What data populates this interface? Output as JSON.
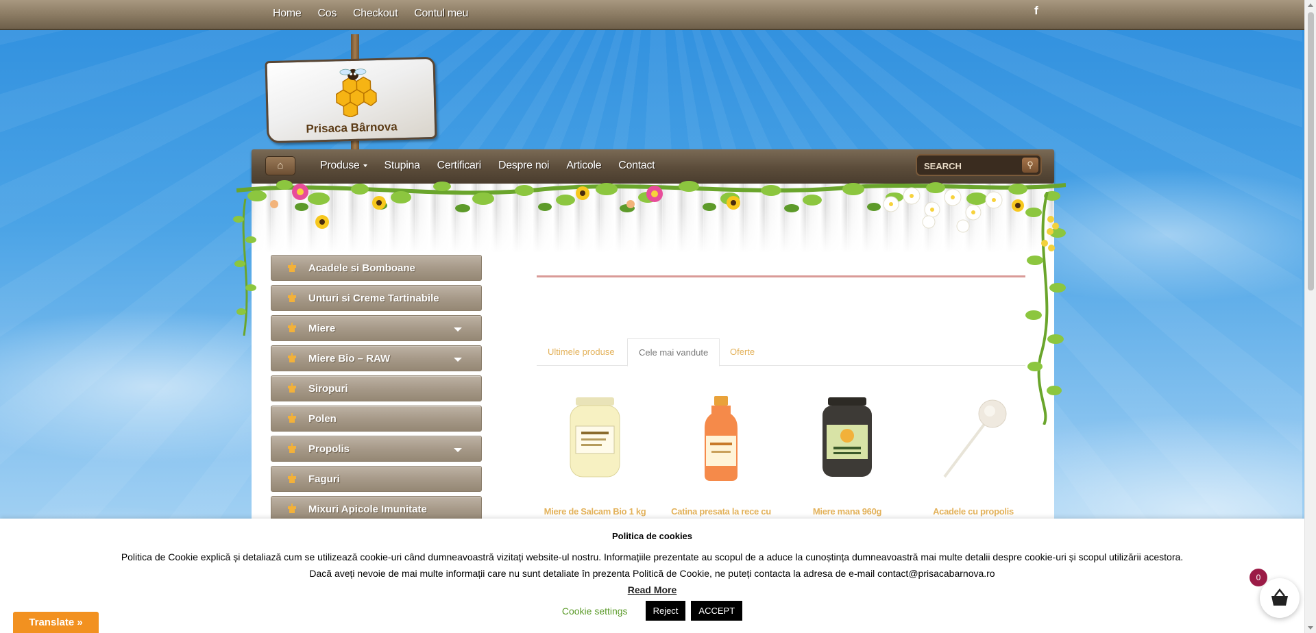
{
  "topbar": {
    "links": [
      "Home",
      "Cos",
      "Checkout",
      "Contul meu"
    ],
    "facebook_icon": "f"
  },
  "logo": {
    "text": "Prisaca Bârnova"
  },
  "mainnav": {
    "home_icon": "home-icon",
    "links": [
      "Produse",
      "Stupina",
      "Certificari",
      "Despre noi",
      "Articole",
      "Contact"
    ],
    "search_placeholder": "SEARCH"
  },
  "sidebar": {
    "categories": [
      {
        "label": "Acadele si Bomboane",
        "expandable": false
      },
      {
        "label": "Unturi si Creme Tartinabile",
        "expandable": false
      },
      {
        "label": "Miere",
        "expandable": true
      },
      {
        "label": "Miere Bio – RAW",
        "expandable": true
      },
      {
        "label": "Siropuri",
        "expandable": false
      },
      {
        "label": "Polen",
        "expandable": false
      },
      {
        "label": "Propolis",
        "expandable": true
      },
      {
        "label": "Faguri",
        "expandable": false
      },
      {
        "label": "Mixuri Apicole Imunitate",
        "expandable": false
      }
    ]
  },
  "tabs": [
    "Ultimele produse",
    "Cele mai vandute",
    "Oferte"
  ],
  "active_tab": "Cele mai vandute",
  "products": [
    {
      "name": "Miere de Salcam Bio 1 kg"
    },
    {
      "name": "Catina presata la rece cu"
    },
    {
      "name": "Miere mana 960g"
    },
    {
      "name": "Acadele cu propolis"
    }
  ],
  "cookie": {
    "title": "Politica de cookies",
    "line1": "Politica de Cookie explică și detaliază cum se utilizează cookie-uri când dumneavoastră vizitați website-ul nostru. Informațiile prezentate au scopul de a aduce la cunoștința dumneavoastră mai multe detalii despre cookie-uri și scopul utilizării acestora.",
    "line2": "Dacă aveți nevoie de mai multe informații care nu sunt detaliate în prezenta Politică de Cookie, ne puteți contacta la adresa de e-mail contact@prisacabarnova.ro",
    "read_more": "Read More",
    "settings": "Cookie settings",
    "reject": "Reject",
    "accept": "ACCEPT"
  },
  "translate_label": "Translate »",
  "cart": {
    "count": "0",
    "icon": "basket-icon"
  },
  "colors": {
    "accent_orange": "#e3b25b",
    "translate_orange": "#f29120",
    "cookie_green": "#5a9a28",
    "cart_badge": "#9b1b46"
  }
}
